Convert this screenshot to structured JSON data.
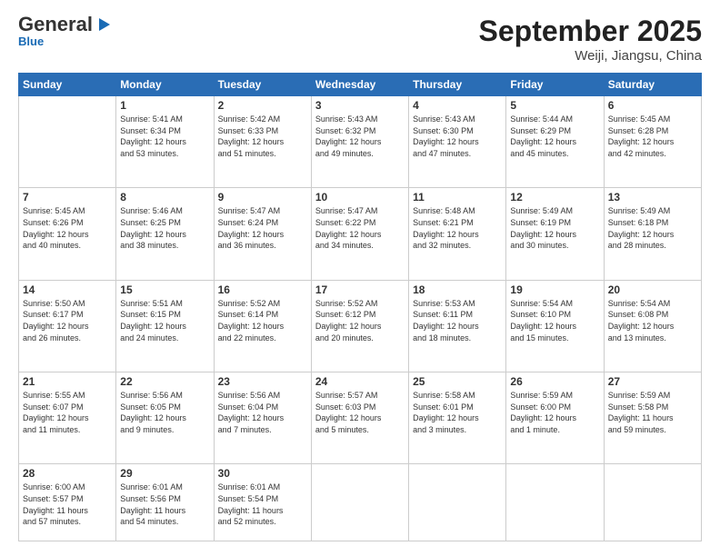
{
  "header": {
    "logo_general": "General",
    "logo_blue": "Blue",
    "month_title": "September 2025",
    "location": "Weiji, Jiangsu, China"
  },
  "weekdays": [
    "Sunday",
    "Monday",
    "Tuesday",
    "Wednesday",
    "Thursday",
    "Friday",
    "Saturday"
  ],
  "rows": [
    [
      {
        "day": "",
        "text": ""
      },
      {
        "day": "1",
        "text": "Sunrise: 5:41 AM\nSunset: 6:34 PM\nDaylight: 12 hours\nand 53 minutes."
      },
      {
        "day": "2",
        "text": "Sunrise: 5:42 AM\nSunset: 6:33 PM\nDaylight: 12 hours\nand 51 minutes."
      },
      {
        "day": "3",
        "text": "Sunrise: 5:43 AM\nSunset: 6:32 PM\nDaylight: 12 hours\nand 49 minutes."
      },
      {
        "day": "4",
        "text": "Sunrise: 5:43 AM\nSunset: 6:30 PM\nDaylight: 12 hours\nand 47 minutes."
      },
      {
        "day": "5",
        "text": "Sunrise: 5:44 AM\nSunset: 6:29 PM\nDaylight: 12 hours\nand 45 minutes."
      },
      {
        "day": "6",
        "text": "Sunrise: 5:45 AM\nSunset: 6:28 PM\nDaylight: 12 hours\nand 42 minutes."
      }
    ],
    [
      {
        "day": "7",
        "text": "Sunrise: 5:45 AM\nSunset: 6:26 PM\nDaylight: 12 hours\nand 40 minutes."
      },
      {
        "day": "8",
        "text": "Sunrise: 5:46 AM\nSunset: 6:25 PM\nDaylight: 12 hours\nand 38 minutes."
      },
      {
        "day": "9",
        "text": "Sunrise: 5:47 AM\nSunset: 6:24 PM\nDaylight: 12 hours\nand 36 minutes."
      },
      {
        "day": "10",
        "text": "Sunrise: 5:47 AM\nSunset: 6:22 PM\nDaylight: 12 hours\nand 34 minutes."
      },
      {
        "day": "11",
        "text": "Sunrise: 5:48 AM\nSunset: 6:21 PM\nDaylight: 12 hours\nand 32 minutes."
      },
      {
        "day": "12",
        "text": "Sunrise: 5:49 AM\nSunset: 6:19 PM\nDaylight: 12 hours\nand 30 minutes."
      },
      {
        "day": "13",
        "text": "Sunrise: 5:49 AM\nSunset: 6:18 PM\nDaylight: 12 hours\nand 28 minutes."
      }
    ],
    [
      {
        "day": "14",
        "text": "Sunrise: 5:50 AM\nSunset: 6:17 PM\nDaylight: 12 hours\nand 26 minutes."
      },
      {
        "day": "15",
        "text": "Sunrise: 5:51 AM\nSunset: 6:15 PM\nDaylight: 12 hours\nand 24 minutes."
      },
      {
        "day": "16",
        "text": "Sunrise: 5:52 AM\nSunset: 6:14 PM\nDaylight: 12 hours\nand 22 minutes."
      },
      {
        "day": "17",
        "text": "Sunrise: 5:52 AM\nSunset: 6:12 PM\nDaylight: 12 hours\nand 20 minutes."
      },
      {
        "day": "18",
        "text": "Sunrise: 5:53 AM\nSunset: 6:11 PM\nDaylight: 12 hours\nand 18 minutes."
      },
      {
        "day": "19",
        "text": "Sunrise: 5:54 AM\nSunset: 6:10 PM\nDaylight: 12 hours\nand 15 minutes."
      },
      {
        "day": "20",
        "text": "Sunrise: 5:54 AM\nSunset: 6:08 PM\nDaylight: 12 hours\nand 13 minutes."
      }
    ],
    [
      {
        "day": "21",
        "text": "Sunrise: 5:55 AM\nSunset: 6:07 PM\nDaylight: 12 hours\nand 11 minutes."
      },
      {
        "day": "22",
        "text": "Sunrise: 5:56 AM\nSunset: 6:05 PM\nDaylight: 12 hours\nand 9 minutes."
      },
      {
        "day": "23",
        "text": "Sunrise: 5:56 AM\nSunset: 6:04 PM\nDaylight: 12 hours\nand 7 minutes."
      },
      {
        "day": "24",
        "text": "Sunrise: 5:57 AM\nSunset: 6:03 PM\nDaylight: 12 hours\nand 5 minutes."
      },
      {
        "day": "25",
        "text": "Sunrise: 5:58 AM\nSunset: 6:01 PM\nDaylight: 12 hours\nand 3 minutes."
      },
      {
        "day": "26",
        "text": "Sunrise: 5:59 AM\nSunset: 6:00 PM\nDaylight: 12 hours\nand 1 minute."
      },
      {
        "day": "27",
        "text": "Sunrise: 5:59 AM\nSunset: 5:58 PM\nDaylight: 11 hours\nand 59 minutes."
      }
    ],
    [
      {
        "day": "28",
        "text": "Sunrise: 6:00 AM\nSunset: 5:57 PM\nDaylight: 11 hours\nand 57 minutes."
      },
      {
        "day": "29",
        "text": "Sunrise: 6:01 AM\nSunset: 5:56 PM\nDaylight: 11 hours\nand 54 minutes."
      },
      {
        "day": "30",
        "text": "Sunrise: 6:01 AM\nSunset: 5:54 PM\nDaylight: 11 hours\nand 52 minutes."
      },
      {
        "day": "",
        "text": ""
      },
      {
        "day": "",
        "text": ""
      },
      {
        "day": "",
        "text": ""
      },
      {
        "day": "",
        "text": ""
      }
    ]
  ]
}
